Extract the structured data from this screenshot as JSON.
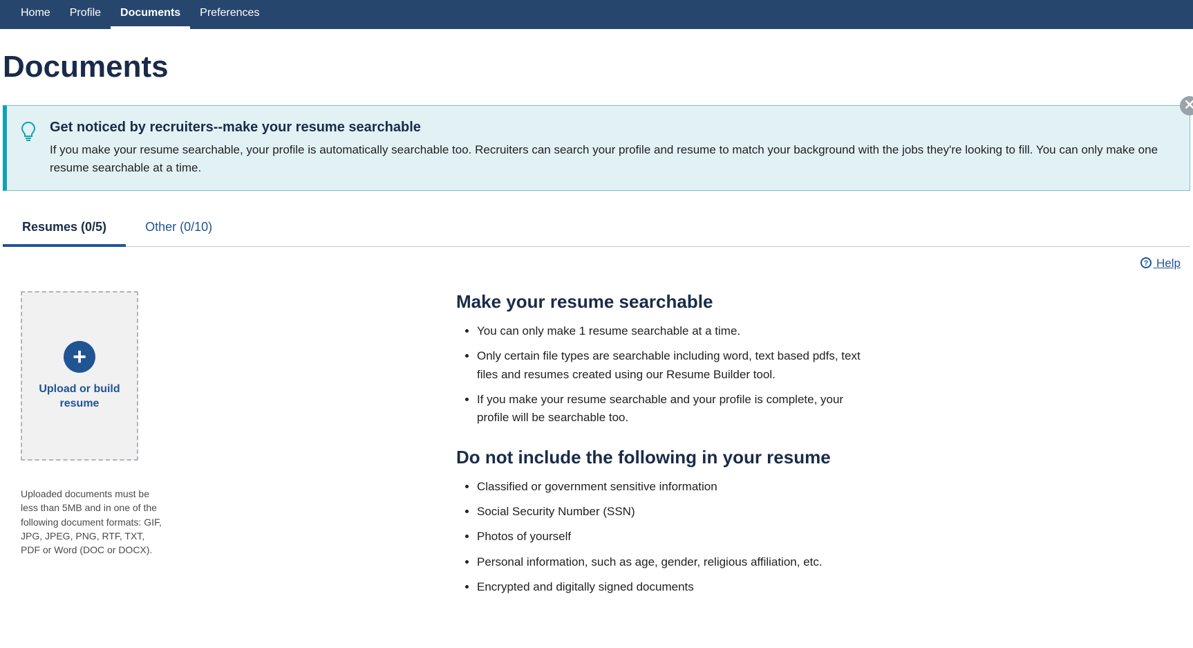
{
  "nav": {
    "items": [
      {
        "label": "Home"
      },
      {
        "label": "Profile"
      },
      {
        "label": "Documents"
      },
      {
        "label": "Preferences"
      }
    ],
    "active_index": 2
  },
  "page_title": "Documents",
  "banner": {
    "heading": "Get noticed by recruiters--make your resume searchable",
    "body": "If you make your resume searchable, your profile is automatically searchable too. Recruiters can search your profile and resume to match your background with the jobs they're looking to fill. You can only make one resume searchable at a time."
  },
  "tabs": {
    "items": [
      {
        "label": "Resumes (0/5)"
      },
      {
        "label": "Other (0/10)"
      }
    ],
    "active_index": 0
  },
  "help_label": "Help",
  "upload": {
    "label": "Upload or build resume",
    "note": "Uploaded documents must be less than 5MB and in one of the following document formats: GIF, JPG, JPEG, PNG, RTF, TXT, PDF or Word (DOC or DOCX)."
  },
  "section1": {
    "heading": "Make your resume searchable",
    "items": [
      "You can only make 1 resume searchable at a time.",
      "Only certain file types are searchable including word, text based pdfs, text files and resumes created using our Resume Builder tool.",
      "If you make your resume searchable and your profile is complete, your profile will be searchable too."
    ]
  },
  "section2": {
    "heading": "Do not include the following in your resume",
    "items": [
      "Classified or government sensitive information",
      "Social Security Number (SSN)",
      "Photos of yourself",
      "Personal information, such as age, gender, religious affiliation, etc.",
      "Encrypted and digitally signed documents"
    ]
  }
}
